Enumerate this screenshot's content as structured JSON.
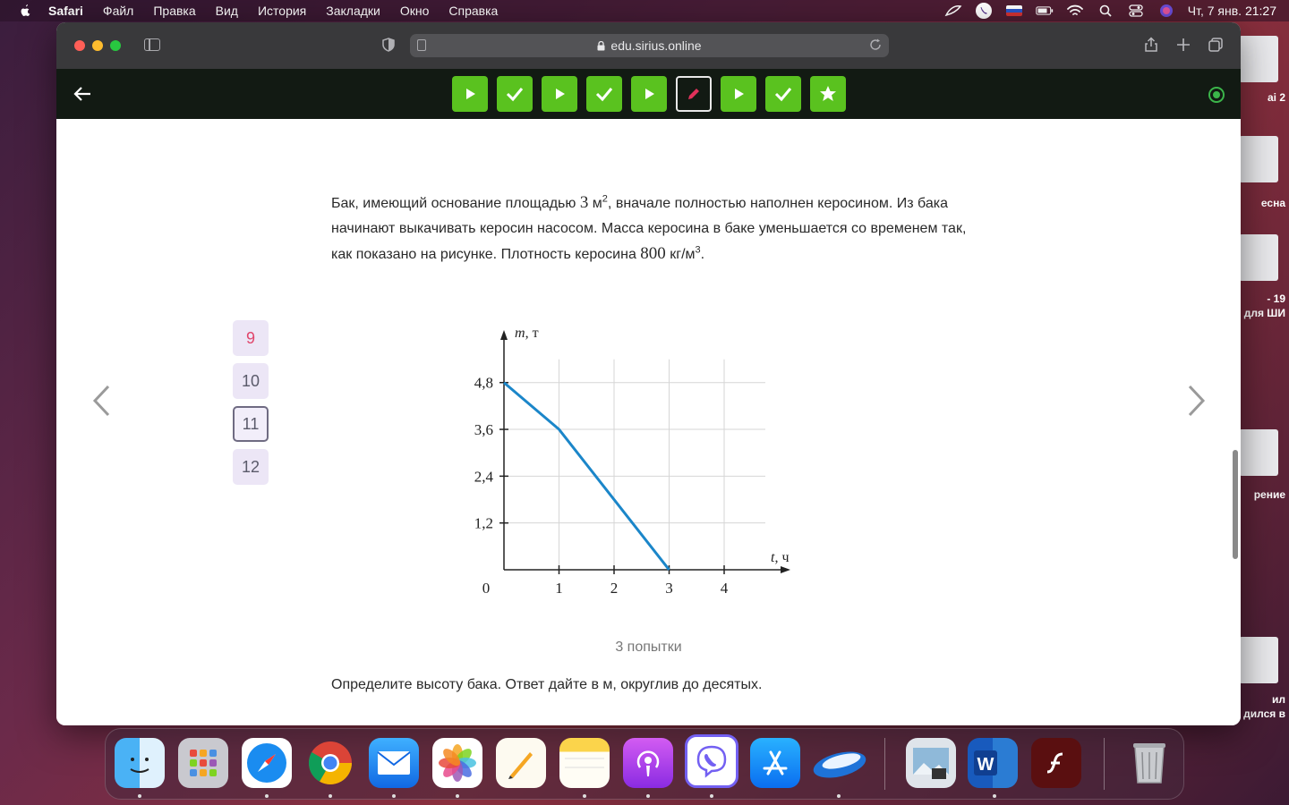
{
  "menubar": {
    "app": "Safari",
    "items": [
      "Файл",
      "Правка",
      "Вид",
      "История",
      "Закладки",
      "Окно",
      "Справка"
    ],
    "clock": "Чт, 7 янв.  21:27"
  },
  "desktop": {
    "labels": [
      "ai 2",
      "есна",
      "- 19",
      "для ШИ",
      "рение",
      "ил",
      "дился в"
    ]
  },
  "browser": {
    "url": "edu.sirius.online"
  },
  "steps": [
    {
      "type": "play"
    },
    {
      "type": "check"
    },
    {
      "type": "play"
    },
    {
      "type": "check"
    },
    {
      "type": "play"
    },
    {
      "type": "pencil",
      "current": true
    },
    {
      "type": "play"
    },
    {
      "type": "check"
    },
    {
      "type": "star"
    }
  ],
  "problem": {
    "text_1": "Бак, имеющий основание площадью ",
    "area_value": "3",
    "area_unit": " м",
    "area_exp": "2",
    "text_2": ", вначале полностью наполнен керосином. Из бака начинают выкачивать керосин насосом. Масса керосина в баке уменьшается со временем так, как показано на рисунке. Плотность керосина ",
    "density_value": "800",
    "density_unit": " кг/м",
    "density_exp": "3",
    "text_3": "."
  },
  "questions": [
    {
      "label": "9",
      "state": "red"
    },
    {
      "label": "10",
      "state": "normal"
    },
    {
      "label": "11",
      "state": "active"
    },
    {
      "label": "12",
      "state": "normal"
    }
  ],
  "chart_data": {
    "type": "line",
    "xlabel": "t, ч",
    "ylabel": "m, т",
    "x_ticks": [
      "0",
      "1",
      "2",
      "3",
      "4"
    ],
    "y_ticks": [
      "1,2",
      "2,4",
      "3,6",
      "4,8"
    ],
    "xlim": [
      0,
      4.6
    ],
    "ylim": [
      0,
      4.8
    ],
    "grid": true,
    "series": [
      {
        "x": [
          0,
          1,
          3
        ],
        "y": [
          4.8,
          3.6,
          0
        ]
      }
    ],
    "line_color": "#1b86c9"
  },
  "attempts": "3 попытки",
  "question": "Определите высоту бака. Ответ дайте в м, округлив до десятых.",
  "dock": [
    "Finder",
    "Launchpad",
    "Safari",
    "Chrome",
    "Mail",
    "Photos",
    "Pages",
    "Notes",
    "Podcasts",
    "Viber",
    "App Store",
    "Yandex Disk",
    "Preview",
    "Word",
    "Flash",
    "Trash"
  ]
}
